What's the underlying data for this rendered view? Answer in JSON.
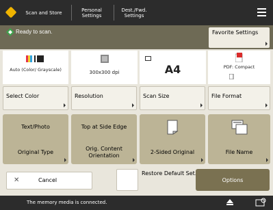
{
  "header": {
    "tabs": [
      {
        "label": "Scan and Store"
      },
      {
        "label": "Personal Settings"
      },
      {
        "label": "Dest./Fwd. Settings"
      }
    ],
    "menu_icon": "hamburger-icon"
  },
  "status": {
    "text": "Ready to scan.",
    "favorite_label": "Favorite Settings"
  },
  "summary": {
    "color_mode": "Auto (Color/ Grayscale)",
    "resolution": "300x300 dpi",
    "size": "A4",
    "file_format": "PDF: Compact"
  },
  "settings_buttons": [
    {
      "label": "Select Color"
    },
    {
      "label": "Resolution"
    },
    {
      "label": "Scan Size"
    },
    {
      "label": "File Format"
    }
  ],
  "tiles": [
    {
      "top": "Text/Photo",
      "bottom": "Original Type"
    },
    {
      "top": "Top at Side Edge",
      "bottom": "Orig. Content Orientation"
    },
    {
      "top": "",
      "bottom": "2-Sided Original"
    },
    {
      "top": "",
      "bottom": "File Name"
    }
  ],
  "actions": {
    "cancel": "Cancel",
    "restore": "Restore Default Set.",
    "options": "Options"
  },
  "footer": {
    "message": "The memory media is connected."
  },
  "colors": {
    "topbar": "#2c2c2c",
    "status_bar": "#6e6a55",
    "tile": "#bcb496",
    "options_button": "#7a7151"
  }
}
